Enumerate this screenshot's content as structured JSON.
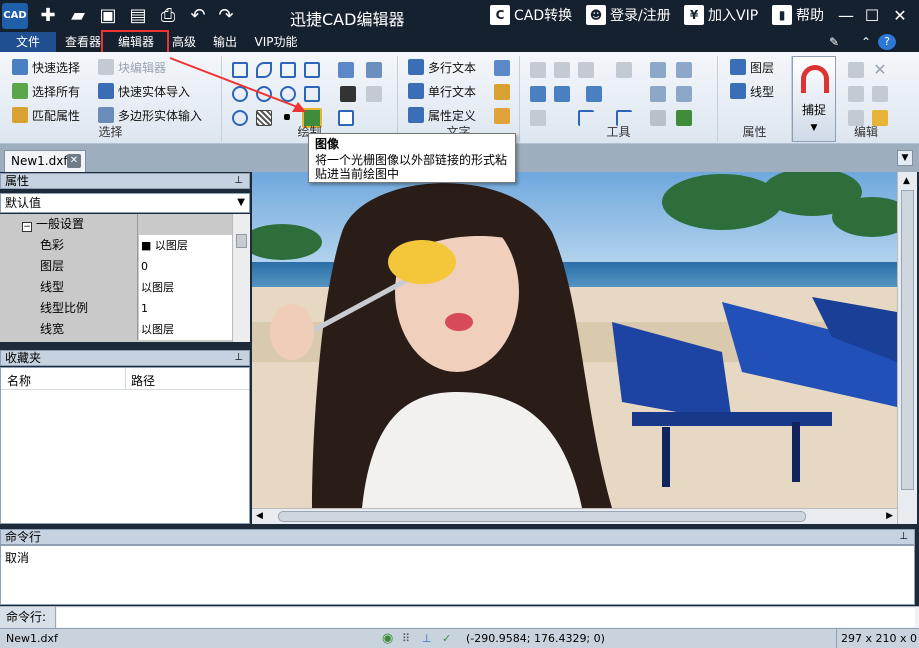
{
  "window": {
    "title": "迅捷CAD编辑器",
    "cad_convert": "CAD转换",
    "login": "登录/注册",
    "vip": "加入VIP",
    "help": "帮助"
  },
  "menu": {
    "items": [
      "文件",
      "查看器",
      "编辑器",
      "高级",
      "输出",
      "VIP功能"
    ]
  },
  "ribbon": {
    "select_group": {
      "label": "选择",
      "quick_select": "快速选择",
      "block_editor": "块编辑器",
      "select_all": "选择所有",
      "quick_entity_import": "快速实体导入",
      "match_props": "匹配属性",
      "polygon_entity_input": "多边形实体输入"
    },
    "draw_group": {
      "label": "绘制"
    },
    "text_group": {
      "label": "文字",
      "mtext": "多行文本",
      "stext": "单行文本",
      "attdef": "属性定义"
    },
    "tools_group": {
      "label": "工具"
    },
    "props_group": {
      "label": "属性",
      "layer": "图层",
      "linetype": "线型"
    },
    "snap": {
      "label": "捕捉"
    },
    "edit_group": {
      "label": "编辑"
    }
  },
  "tooltip": {
    "title": "图像",
    "body": "将一个光栅图像以外部链接的形式粘贴进当前绘图中"
  },
  "tabs": {
    "doc": "New1.dxf"
  },
  "properties": {
    "title": "属性",
    "selector": "默认值",
    "section": "一般设置",
    "rows": [
      {
        "key": "色彩",
        "value": "■ 以图层"
      },
      {
        "key": "图层",
        "value": "0"
      },
      {
        "key": "线型",
        "value": "以图层"
      },
      {
        "key": "线型比例",
        "value": "1"
      },
      {
        "key": "线宽",
        "value": "以图层"
      }
    ]
  },
  "favorites": {
    "title": "收藏夹",
    "col_name": "名称",
    "col_path": "路径"
  },
  "command": {
    "title": "命令行",
    "history": "取消",
    "input_label": "命令行:",
    "input_value": ""
  },
  "statusbar": {
    "file": "New1.dxf",
    "coords": "(-290.9584; 176.4329; 0)",
    "size": "297 x 210 x 0"
  },
  "colors": {
    "titlebar": "#15212e",
    "file_menu": "#1f4f91",
    "highlight": "#e33333"
  }
}
